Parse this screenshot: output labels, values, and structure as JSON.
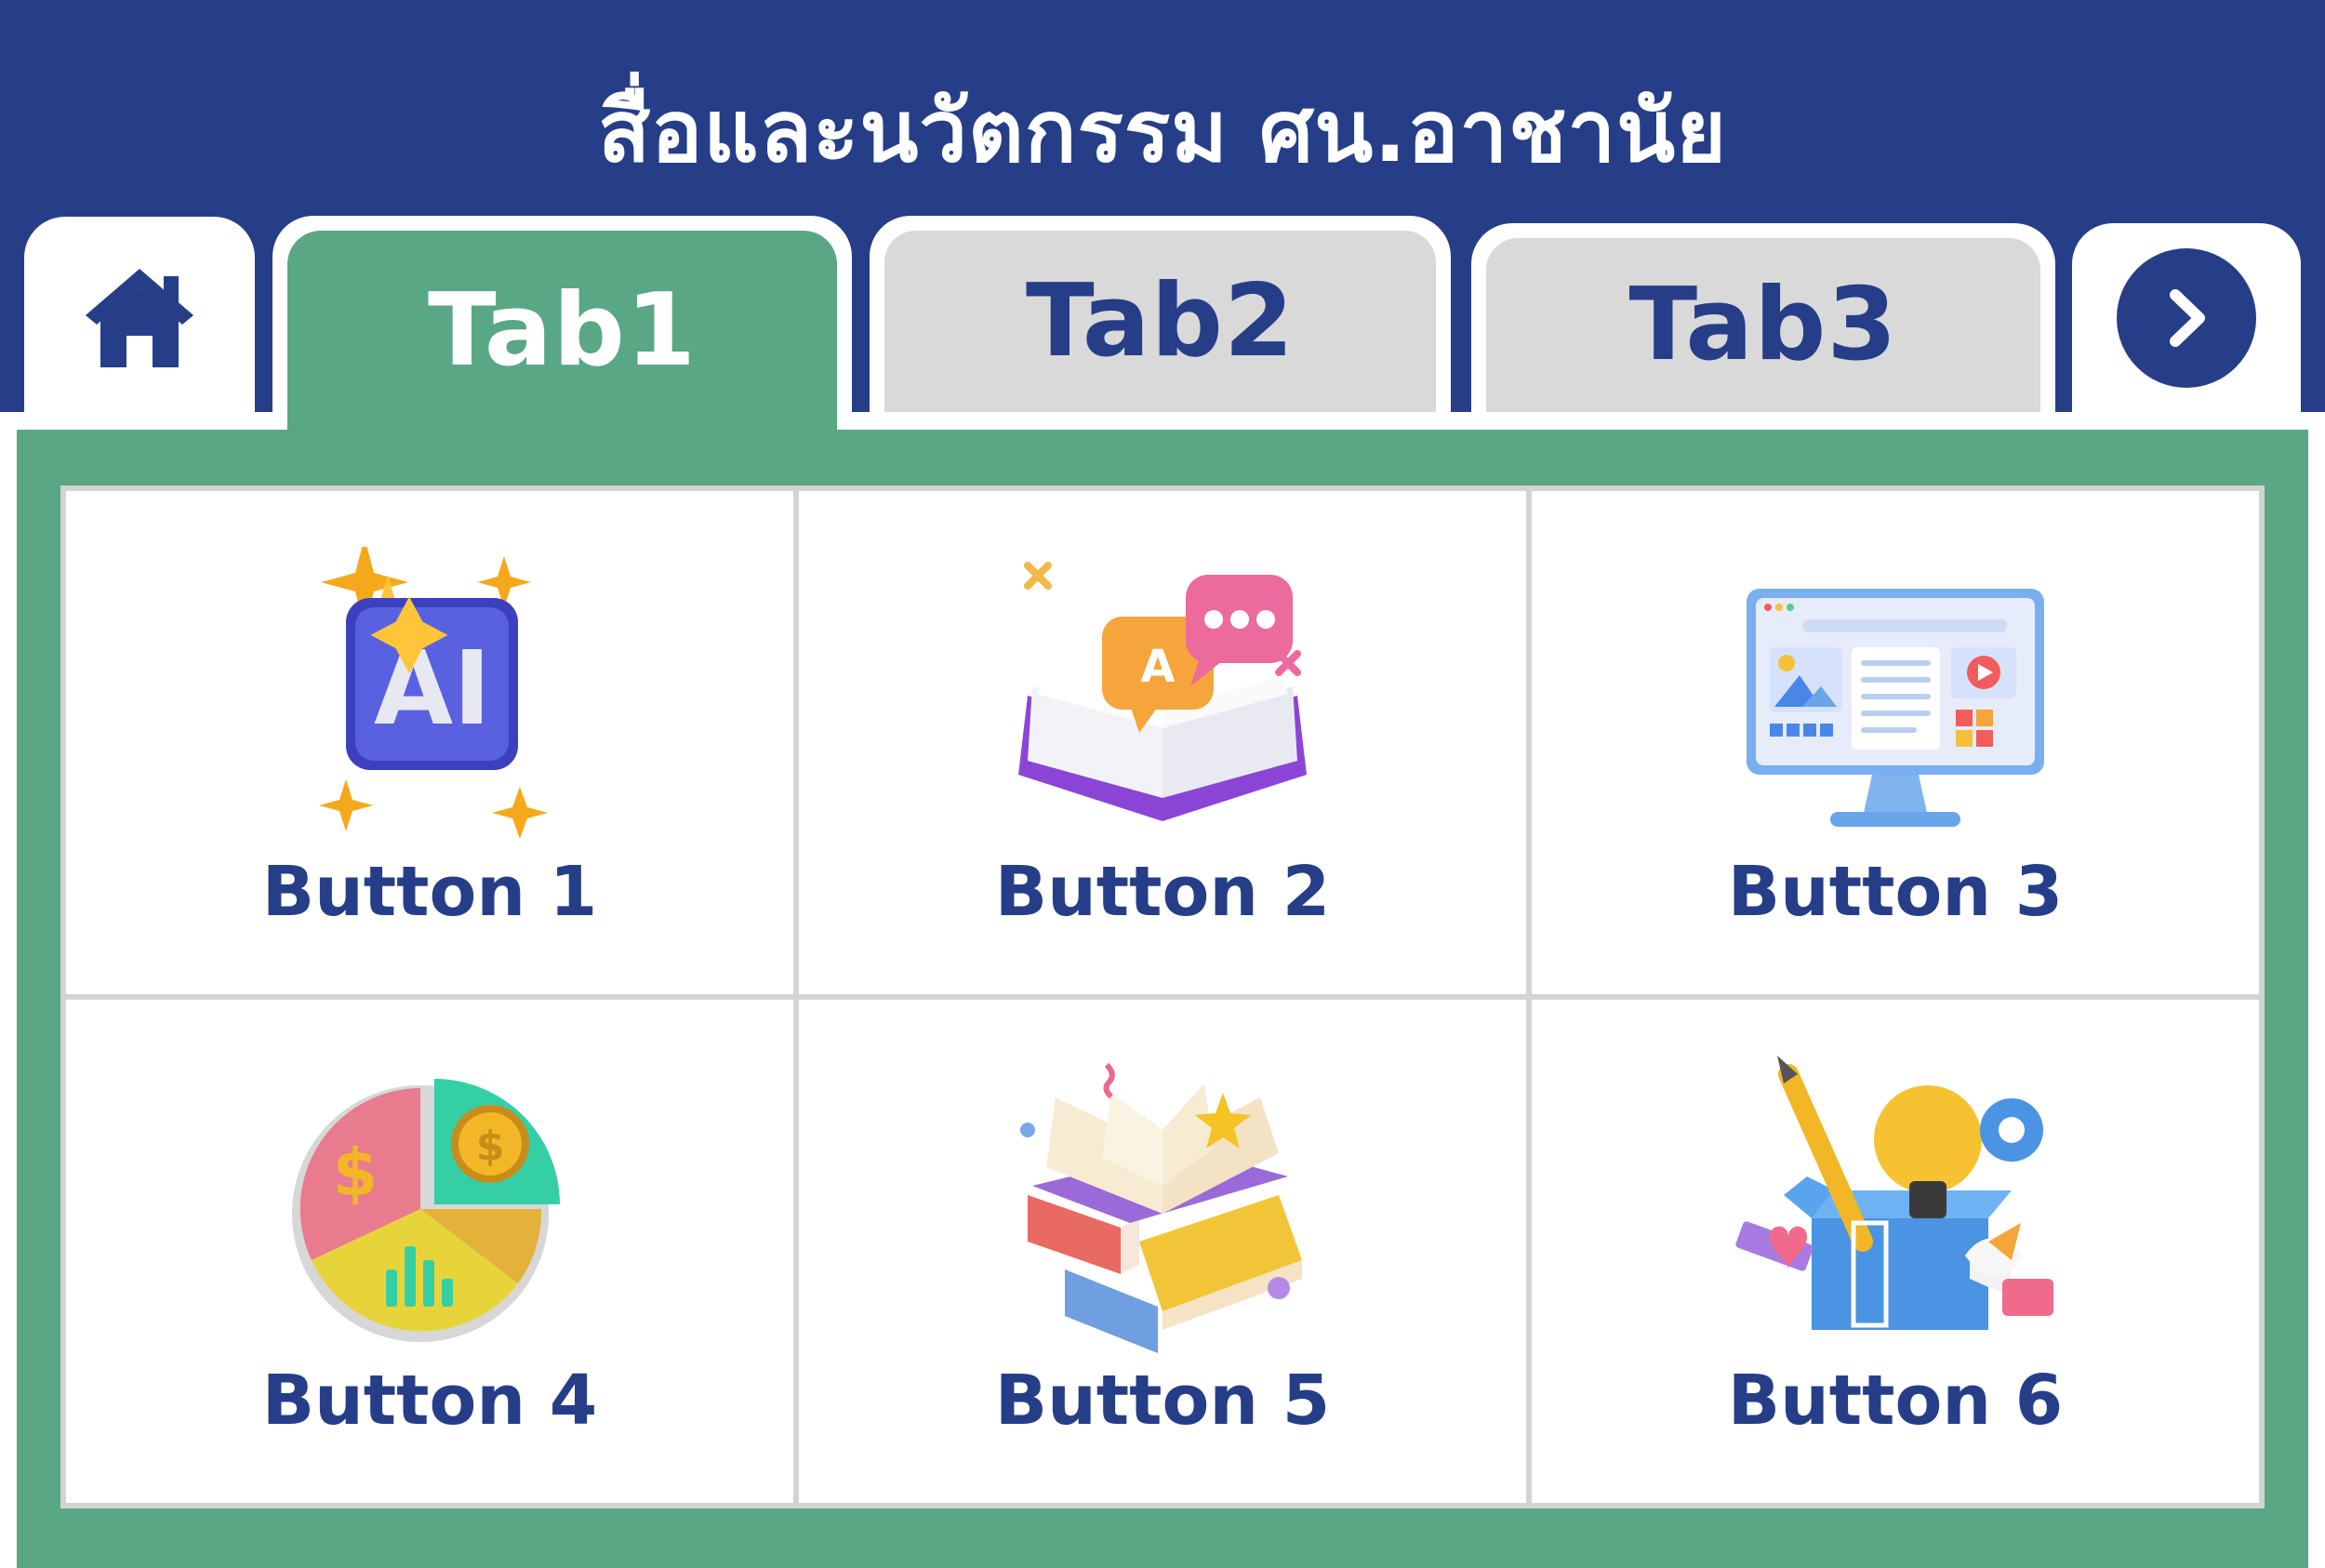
{
  "header": {
    "title": "สื่อและนวัตกรรม ศน.อาชานัย"
  },
  "tabs": [
    {
      "label": "Tab1",
      "active": true
    },
    {
      "label": "Tab2",
      "active": false
    },
    {
      "label": "Tab3",
      "active": false
    }
  ],
  "nav": {
    "home_icon": "home-icon",
    "next_icon": "chevron-right-icon"
  },
  "colors": {
    "header": "#263e88",
    "active_tab": "#59a785",
    "inactive_tab": "#d9d9d9",
    "label_text": "#263e88"
  },
  "buttons": [
    {
      "label": "Button 1",
      "icon": "ai-sparkle-icon"
    },
    {
      "label": "Button 2",
      "icon": "book-chat-icon"
    },
    {
      "label": "Button 3",
      "icon": "monitor-dashboard-icon"
    },
    {
      "label": "Button 4",
      "icon": "pie-chart-coin-icon"
    },
    {
      "label": "Button 5",
      "icon": "stack-of-books-icon"
    },
    {
      "label": "Button 6",
      "icon": "idea-box-icon"
    }
  ]
}
